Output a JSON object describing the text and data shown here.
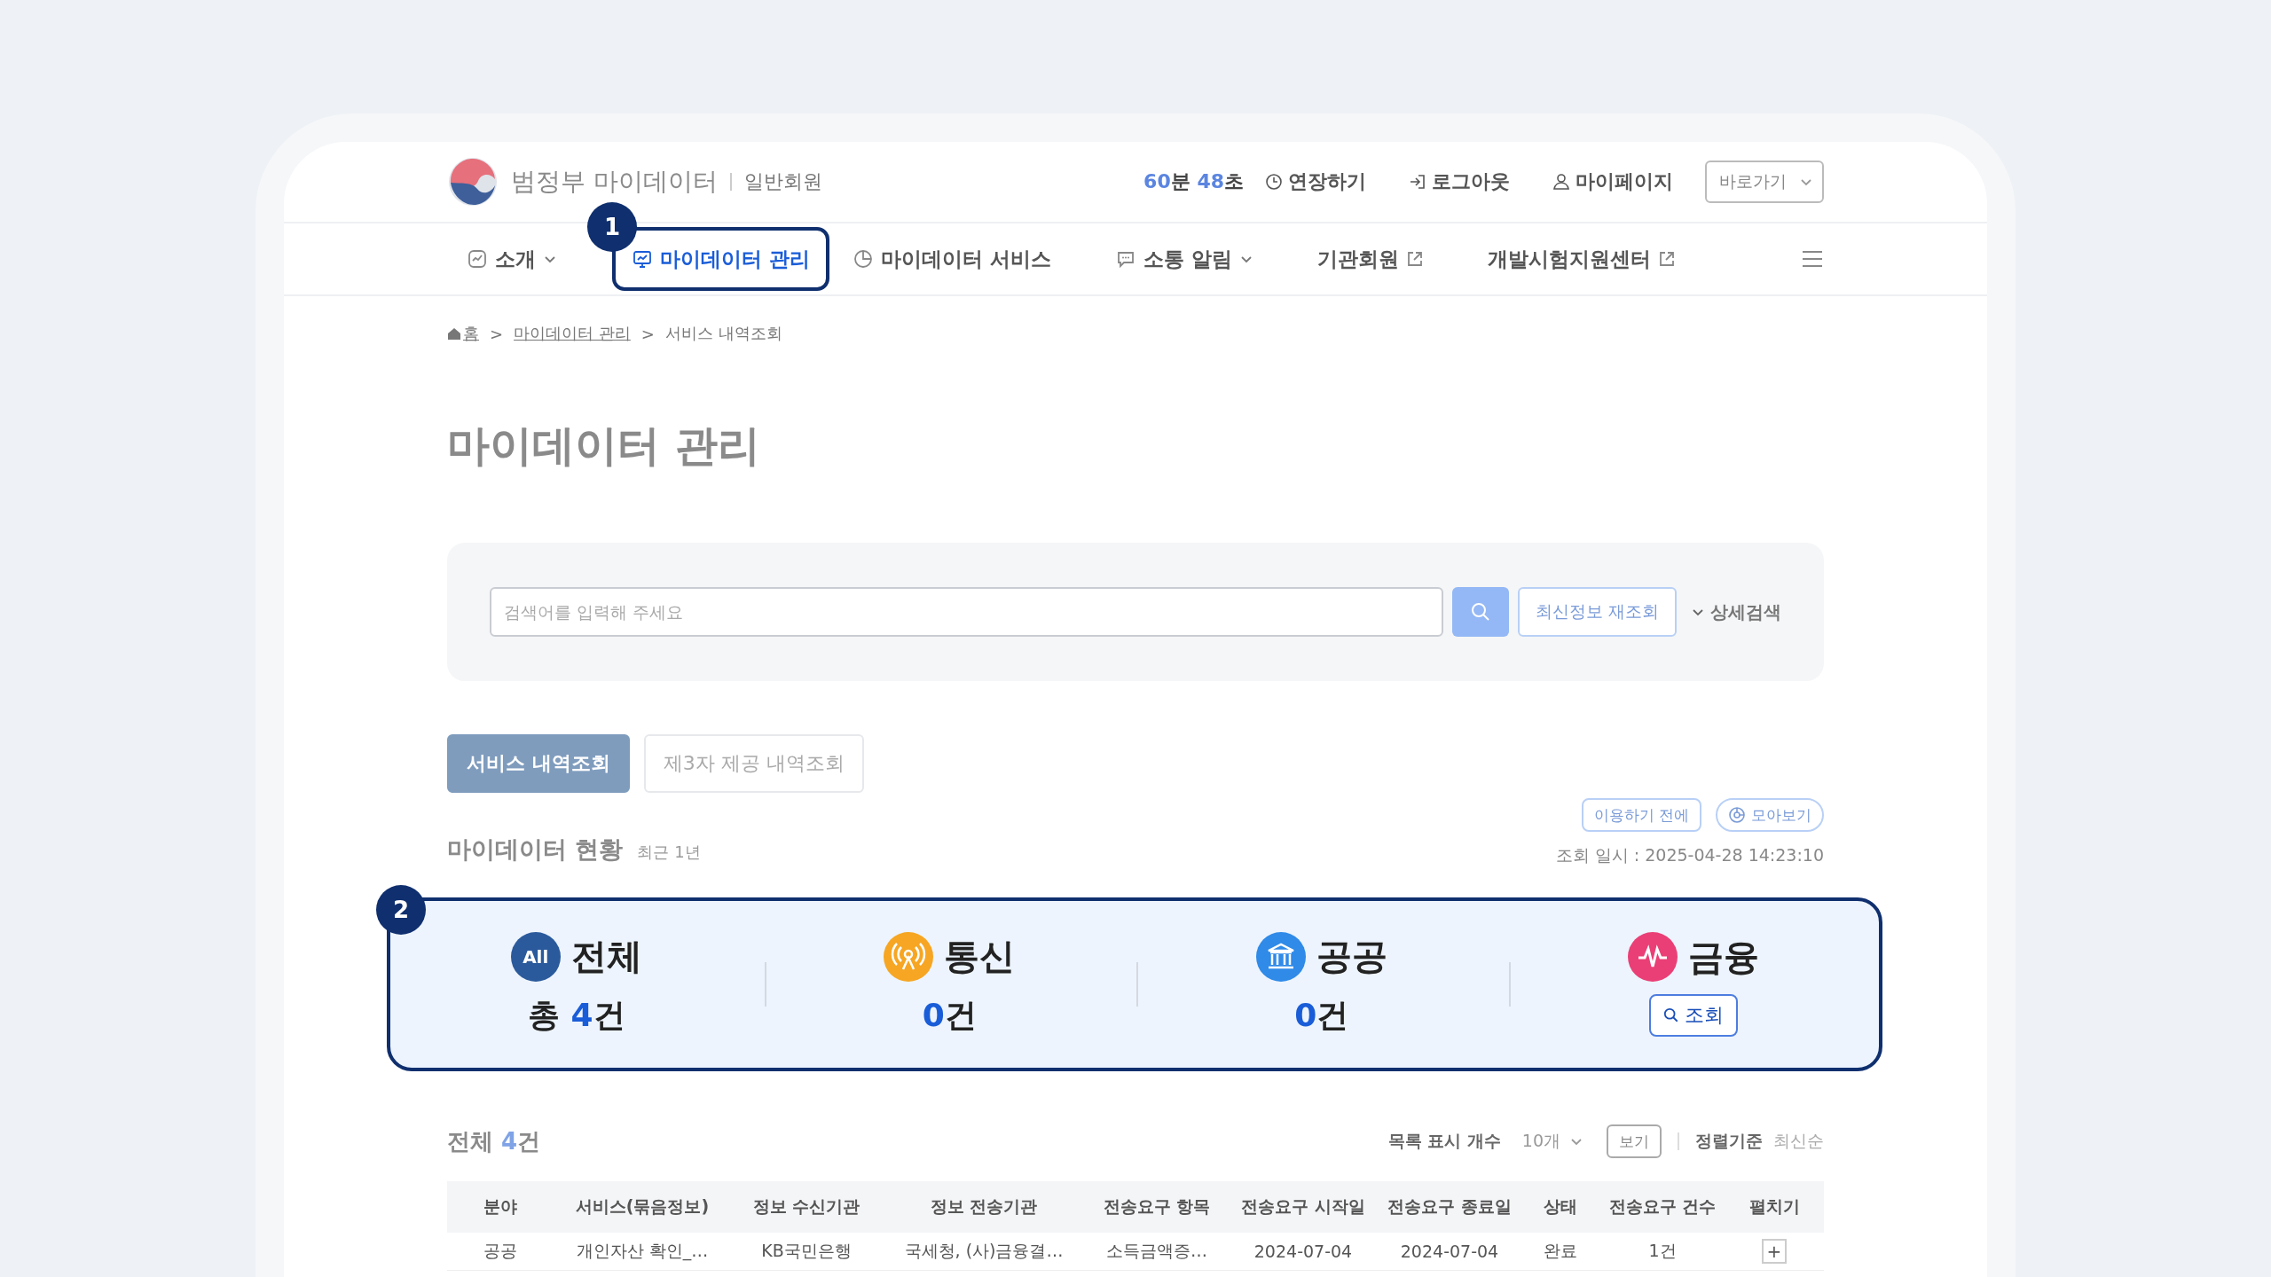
{
  "header": {
    "logo_text": "범정부 마이데이터",
    "member_type": "일반회원",
    "timer": [
      {
        "value": "60",
        "unit": "분"
      },
      {
        "value": "48",
        "unit": "초"
      }
    ],
    "actions": [
      {
        "kind": "extend",
        "label": "연장하기"
      },
      {
        "kind": "logout",
        "label": "로그아웃"
      },
      {
        "kind": "mypage",
        "label": "마이페이지"
      }
    ],
    "shortcut_select": "바로가기"
  },
  "nav": {
    "items": [
      {
        "kind": "chart",
        "label": "소개",
        "dropdown": true,
        "external": false,
        "selected": false
      },
      {
        "kind": "monitor",
        "label": "마이데이터 관리",
        "dropdown": false,
        "external": false,
        "selected": true,
        "annotation": "1"
      },
      {
        "kind": "pie",
        "label": "마이데이터 서비스",
        "dropdown": false,
        "external": false,
        "selected": false
      },
      {
        "kind": "chat",
        "label": "소통 알림",
        "dropdown": true,
        "external": false,
        "selected": false
      },
      {
        "kind": "text",
        "label": "기관회원",
        "dropdown": false,
        "external": true,
        "selected": false
      },
      {
        "kind": "text",
        "label": "개발시험지원센터",
        "dropdown": false,
        "external": true,
        "selected": false
      }
    ]
  },
  "breadcrumb": [
    {
      "kind": "home",
      "label": "홈"
    },
    {
      "kind": "link",
      "separator": ">",
      "label": "마이데이터 관리"
    },
    {
      "kind": "current",
      "separator": ">",
      "label": "서비스 내역조회"
    }
  ],
  "page_title": "마이데이터 관리",
  "search": {
    "placeholder": "검색어를 입력해 주세요",
    "refresh_button": "최신정보 재조회",
    "detail_toggle": "상세검색"
  },
  "tabs": [
    {
      "label": "서비스 내역조회",
      "selected": true
    },
    {
      "label": "제3자 제공 내역조회",
      "selected": false
    }
  ],
  "status": {
    "title": "마이데이터 현황",
    "subtitle": "최근 1년",
    "buttons": [
      {
        "kind": "plain",
        "label": "이용하기 전에"
      },
      {
        "kind": "chart",
        "label": "모아보기"
      }
    ],
    "query_time": "조회 일시 : 2025-04-28 14:23:10"
  },
  "stats": {
    "annotation": "2",
    "categories": [
      {
        "kind": "all",
        "icon_text": "All",
        "name": "전체",
        "prefix": "총",
        "count": "4",
        "unit": "건"
      },
      {
        "kind": "telecom",
        "name": "통신",
        "count": "0",
        "unit": "건"
      },
      {
        "kind": "public",
        "name": "공공",
        "count": "0",
        "unit": "건"
      },
      {
        "kind": "finance",
        "name": "금융",
        "button": "조회"
      }
    ]
  },
  "list": {
    "label": "전체",
    "count": "4",
    "unit": "건",
    "page_size_label": "목록 표시 개수",
    "page_size": "10개",
    "view_button": "보기",
    "sort_label": "정렬기준",
    "sort_value": "최신순",
    "table": {
      "columns": [
        "분야",
        "서비스(묶음정보)",
        "정보 수신기관",
        "정보 전송기관",
        "전송요구 항목",
        "전송요구 시작일",
        "전송요구 종료일",
        "상태",
        "전송요구 건수",
        "펼치기"
      ],
      "rows": [
        {
          "cells": [
            "공공",
            "개인자산 확인_…",
            "KB국민은행",
            "국세청, (사)금융결…",
            "소득금액증…",
            "2024-07-04",
            "2024-07-04",
            "완료",
            "1건"
          ],
          "expand": "+"
        }
      ]
    }
  }
}
